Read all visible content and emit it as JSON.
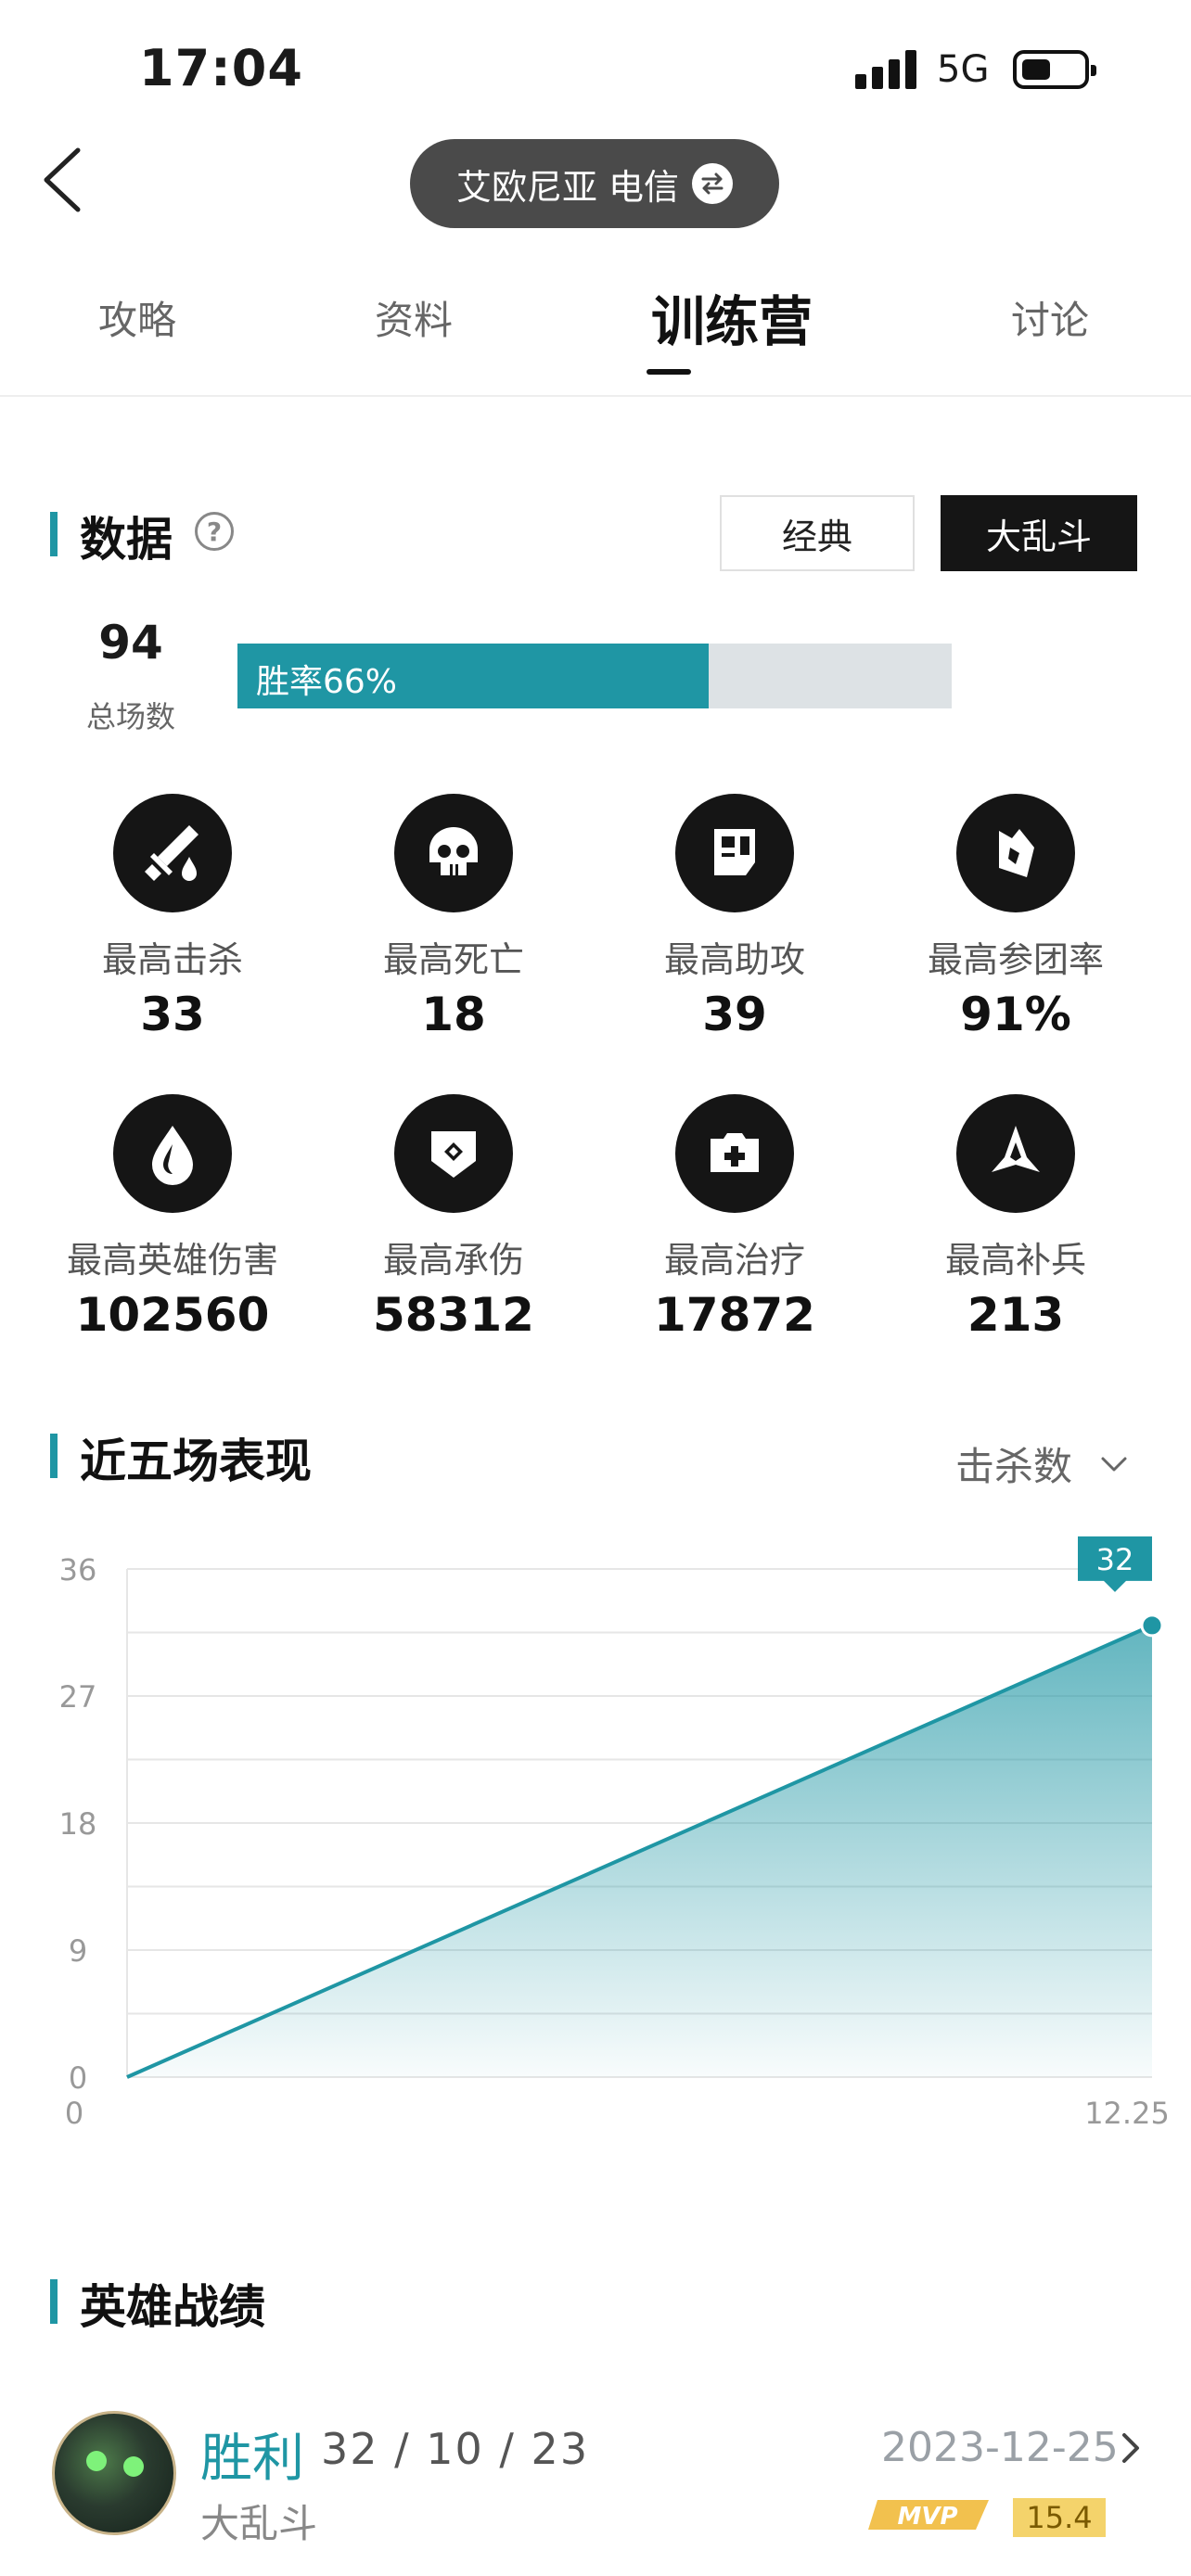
{
  "status": {
    "time": "17:04",
    "network": "5G",
    "battery_level": 0.5
  },
  "header": {
    "server": "艾欧尼亚 电信"
  },
  "tabs": [
    {
      "label": "攻略",
      "active": false
    },
    {
      "label": "资料",
      "active": false
    },
    {
      "label": "训练营",
      "active": true
    },
    {
      "label": "讨论",
      "active": false
    }
  ],
  "data_section": {
    "title": "数据",
    "help": "?",
    "modes": [
      {
        "label": "经典",
        "selected": false
      },
      {
        "label": "大乱斗",
        "selected": true
      }
    ],
    "total_games": "94",
    "total_games_label": "总场数",
    "win_rate_label": "胜率66%",
    "win_rate": 0.66,
    "stats": [
      {
        "label": "最高击杀",
        "value": "33",
        "icon": "sword-drop-icon"
      },
      {
        "label": "最高死亡",
        "value": "18",
        "icon": "skull-icon"
      },
      {
        "label": "最高助攻",
        "value": "39",
        "icon": "assist-hand-icon"
      },
      {
        "label": "最高参团率",
        "value": "91%",
        "icon": "teamfight-icon"
      },
      {
        "label": "最高英雄伤害",
        "value": "102560",
        "icon": "damage-drop-icon"
      },
      {
        "label": "最高承伤",
        "value": "58312",
        "icon": "shield-icon"
      },
      {
        "label": "最高治疗",
        "value": "17872",
        "icon": "heal-kit-icon"
      },
      {
        "label": "最高补兵",
        "value": "213",
        "icon": "minion-icon"
      }
    ]
  },
  "recent_section": {
    "title": "近五场表现",
    "metric": "击杀数"
  },
  "chart_data": {
    "type": "area",
    "x": [
      "",
      "12.25"
    ],
    "values": [
      0,
      32
    ],
    "y_ticks": [
      "0",
      "9",
      "18",
      "27",
      "36"
    ],
    "ylim": [
      0,
      36
    ],
    "x_tick_labels": [
      "0",
      "12.25"
    ],
    "last_point_label": "32",
    "grid": true,
    "colors": {
      "line": "#1f96a4"
    }
  },
  "heroes_section": {
    "title": "英雄战绩",
    "records": [
      {
        "result": "胜利",
        "kda": "32 / 10 / 23",
        "mode": "大乱斗",
        "date": "2023-12-25",
        "mvp_badge": "MVP",
        "score": "15.4"
      }
    ]
  },
  "colors": {
    "accent": "#1f96a4",
    "dark": "#151515",
    "win_rate_track": "#dde2e5"
  }
}
